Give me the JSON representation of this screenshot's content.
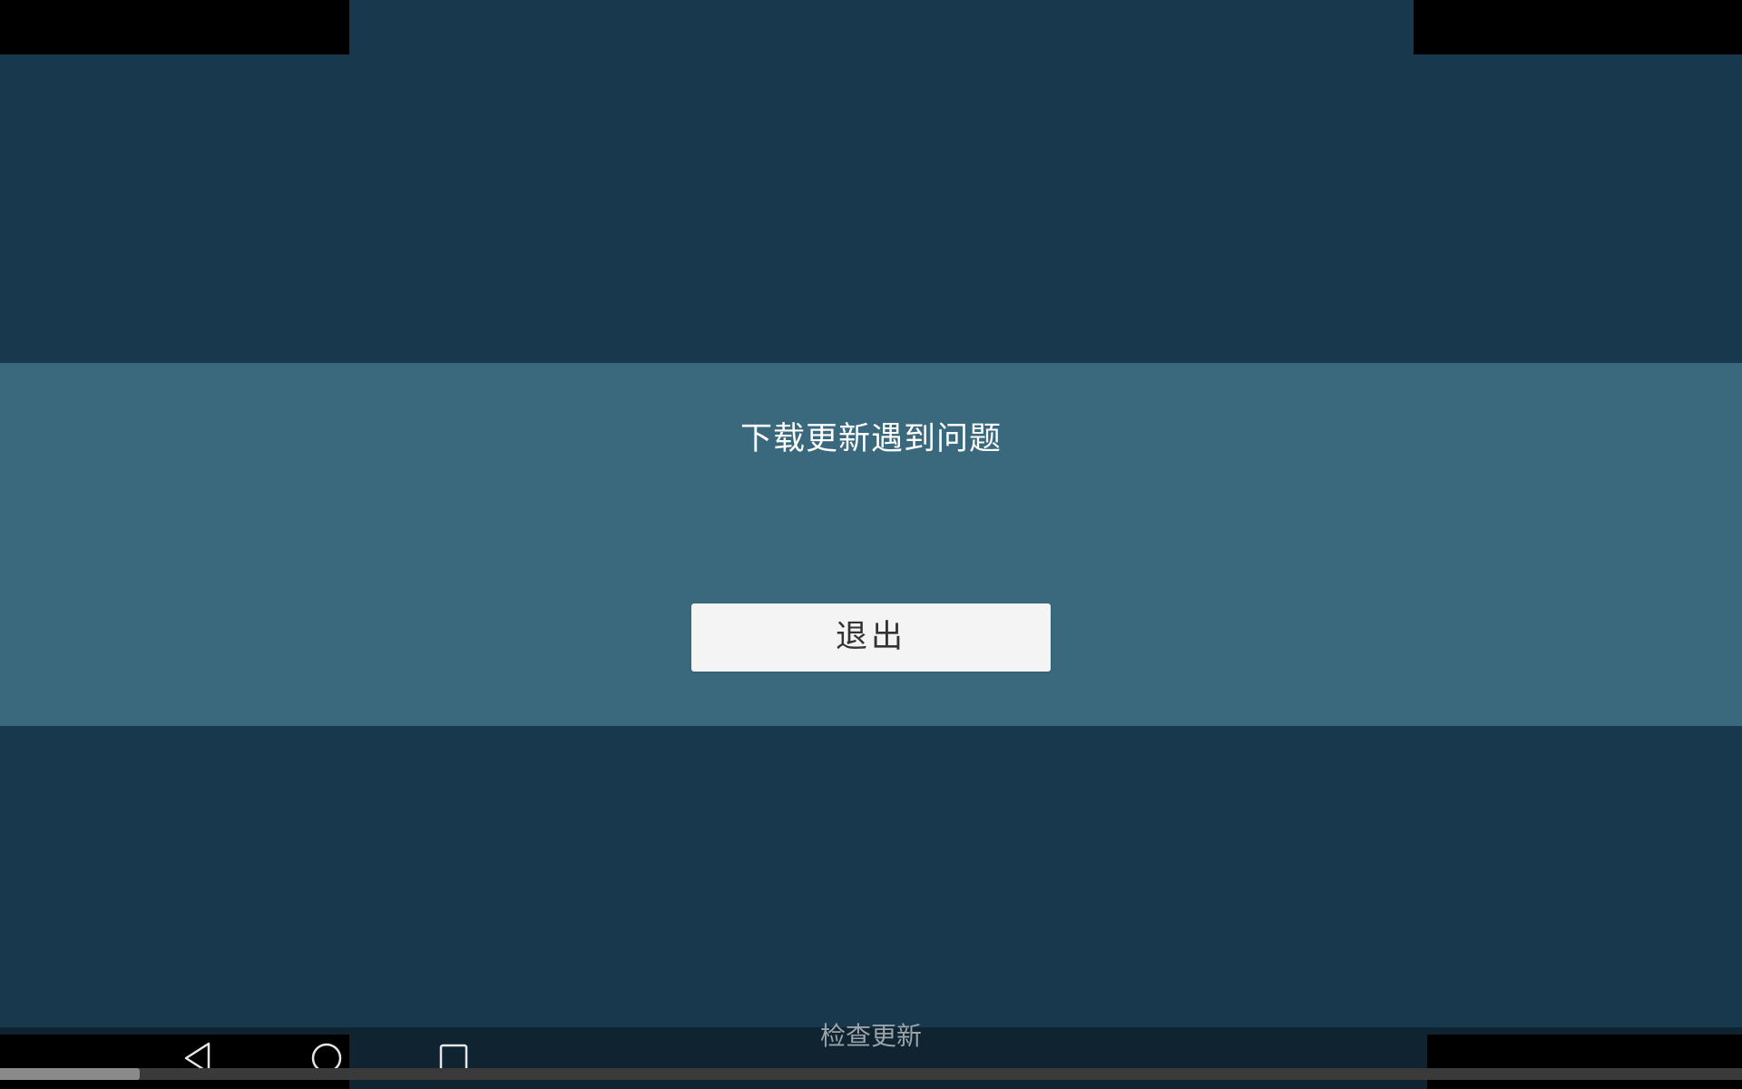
{
  "dialog": {
    "message": "下载更新遇到问题",
    "exit_label": "退出"
  },
  "footer": {
    "check_update_label": "检查更新"
  },
  "navigation_bar": {
    "icons": [
      "back-icon",
      "home-icon",
      "recents-icon"
    ]
  },
  "progress": {
    "fraction": 0.08
  },
  "colors": {
    "background": "#17384d",
    "dialog_band": "#3a697e",
    "button": "#f5f4f5",
    "progress_fill": "#8a8a8a"
  }
}
